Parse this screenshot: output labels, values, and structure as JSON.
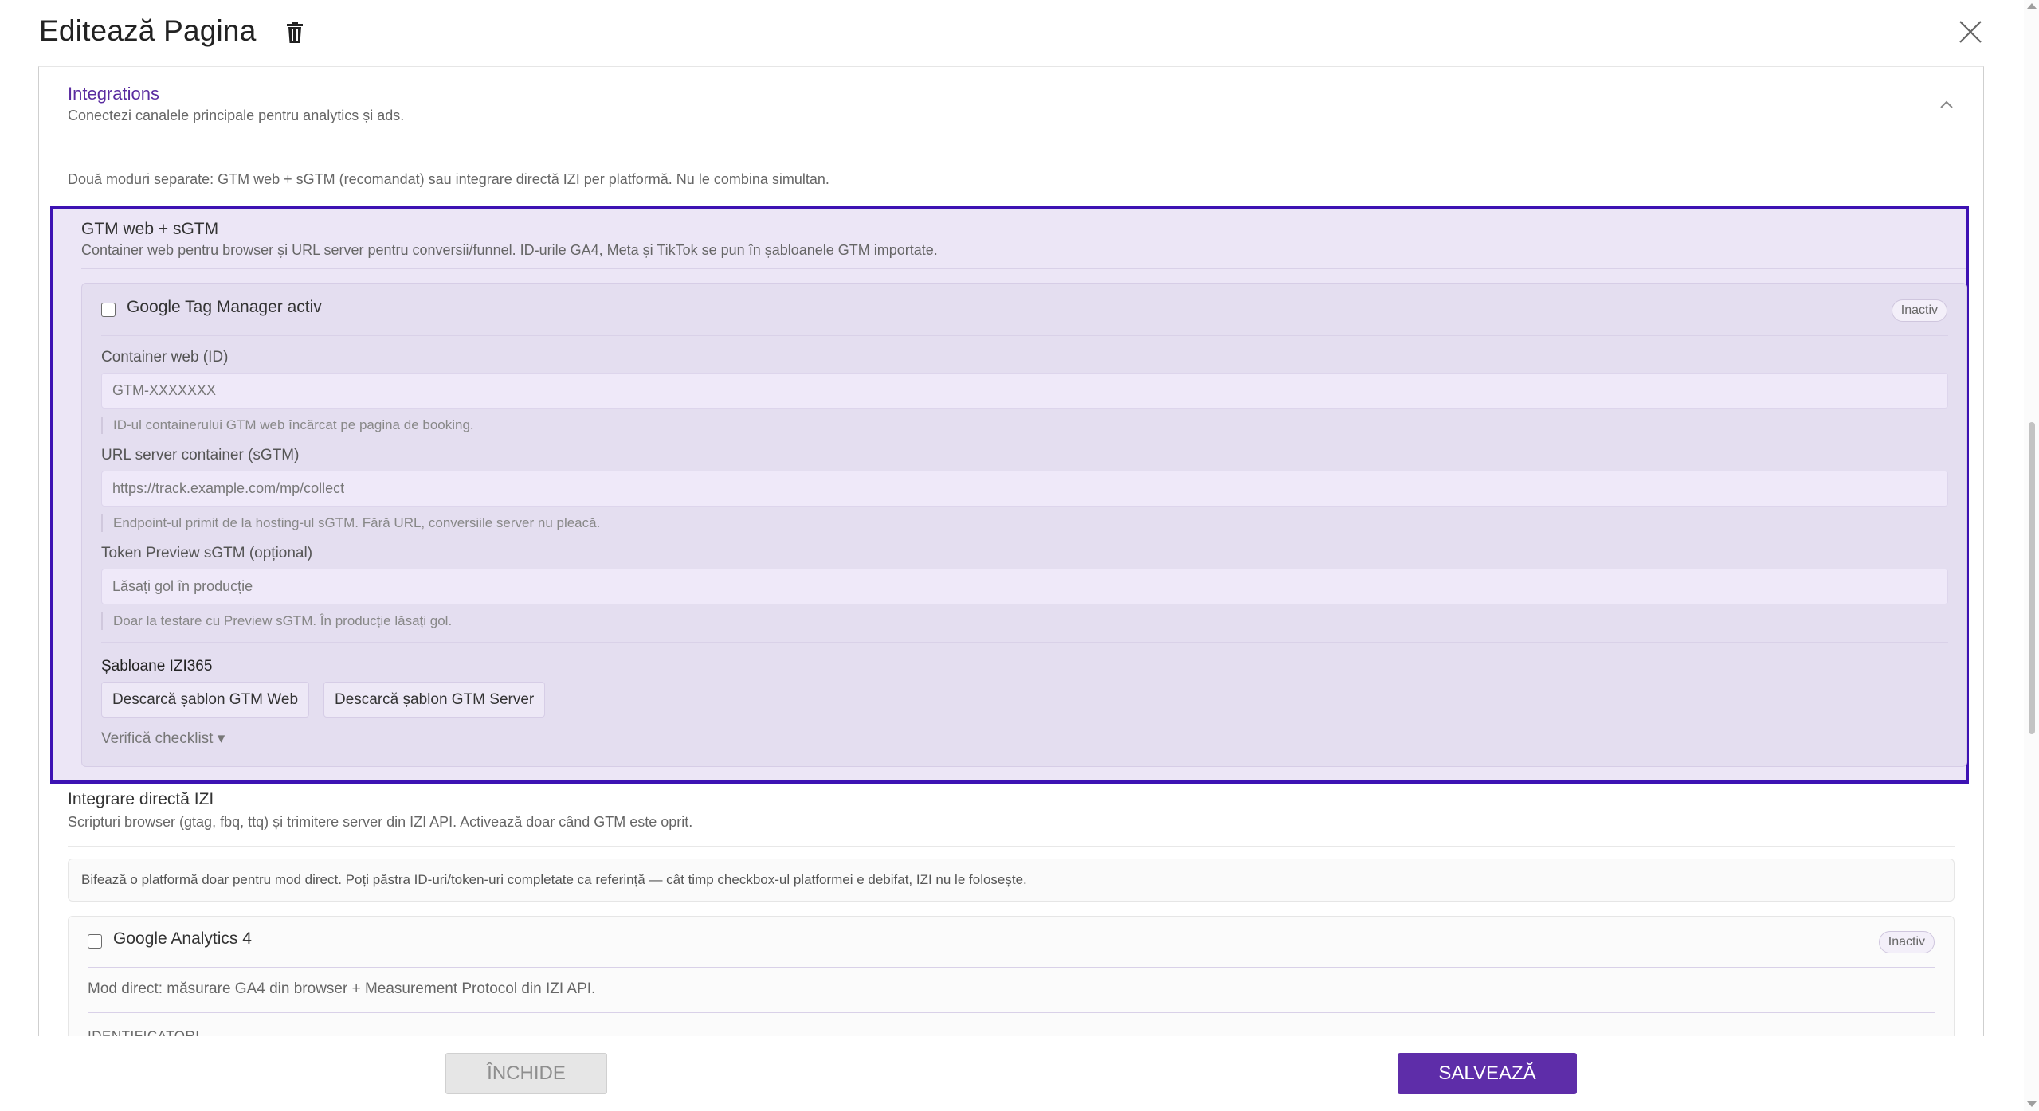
{
  "header": {
    "title": "Editează Pagina"
  },
  "section": {
    "title": "Integrations",
    "subtitle": "Conectezi canalele principale pentru analytics și ads.",
    "intro": "Două moduri separate: GTM web + sGTM (recomandat) sau integrare directă IZI per platformă. Nu le combina simultan."
  },
  "gtm": {
    "title": "GTM web + sGTM",
    "subtitle": "Container web pentru browser și URL server pentru conversii/funnel. ID-urile GA4, Meta și TikTok se pun în șabloanele GTM importate.",
    "toggle_label": "Google Tag Manager activ",
    "status": "Inactiv",
    "container_label": "Container web (ID)",
    "container_placeholder": "GTM-XXXXXXX",
    "container_hint": "ID-ul containerului GTM web încărcat pe pagina de booking.",
    "server_label": "URL server container (sGTM)",
    "server_placeholder": "https://track.example.com/mp/collect",
    "server_hint": "Endpoint-ul primit de la hosting-ul sGTM. Fără URL, conversiile server nu pleacă.",
    "token_label": "Token Preview sGTM (opțional)",
    "token_placeholder": "Lăsați gol în producție",
    "token_hint": "Doar la testare cu Preview sGTM. În producție lăsați gol.",
    "templates_label": "Șabloane IZI365",
    "download_web": "Descarcă șablon GTM Web",
    "download_server": "Descarcă șablon GTM Server",
    "verify": "Verifică checklist ▾"
  },
  "direct": {
    "title": "Integrare directă IZI",
    "subtitle": "Scripturi browser (gtag, fbq, ttq) și trimitere server din IZI API. Activează doar când GTM este oprit.",
    "notice": "Bifează o platformă doar pentru mod direct. Poți păstra ID-uri/token-uri completate ca referință — cât timp checkbox-ul platformei e debifat, IZI nu le folosește.",
    "ga4": {
      "label": "Google Analytics 4",
      "status": "Inactiv",
      "description": "Mod direct: măsurare GA4 din browser + Measurement Protocol din IZI API.",
      "section": "IDENTIFICATORI"
    }
  },
  "footer": {
    "close": "ÎNCHIDE",
    "save": "SALVEAZĂ"
  },
  "colors": {
    "accent": "#5e2da9",
    "highlight_border": "#3d12b3",
    "panel_bg": "#ece6f6"
  }
}
